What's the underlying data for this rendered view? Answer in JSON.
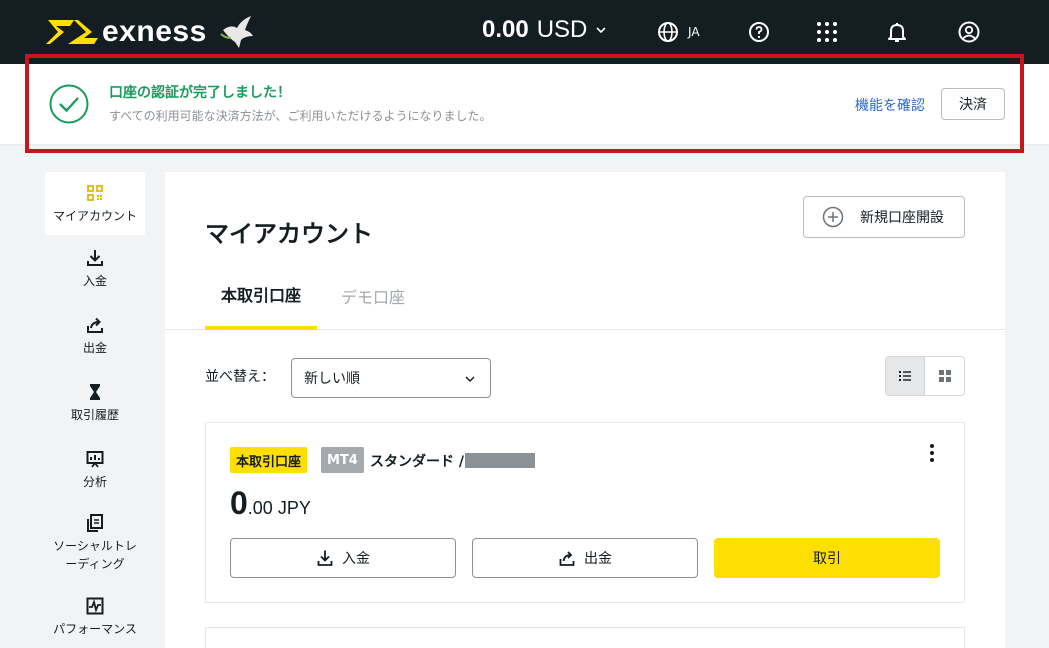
{
  "header": {
    "brand": "exness",
    "balance_amount": "0.00",
    "balance_currency": "USD",
    "language": "JA"
  },
  "banner": {
    "title": "口座の認証が完了しました！",
    "subtitle": "すべての利用可能な決済方法が、ご利用いただけるようになりました。",
    "link_label": "機能を確認",
    "button_label": "決済"
  },
  "sidebar": {
    "items": [
      {
        "label": "マイアカウント",
        "icon": "grid-dashboard-icon"
      },
      {
        "label": "入金",
        "icon": "download-icon"
      },
      {
        "label": "出金",
        "icon": "upload-share-icon"
      },
      {
        "label": "取引履歴",
        "icon": "hourglass-icon"
      },
      {
        "label": "分析",
        "icon": "chart-board-icon"
      },
      {
        "label": "ソーシャルトレーディング",
        "icon": "copy-document-icon"
      },
      {
        "label": "パフォーマンス",
        "icon": "pulse-chart-icon"
      }
    ]
  },
  "main": {
    "title": "マイアカウント",
    "new_account_label": "新規口座開設",
    "tabs": [
      {
        "label": "本取引口座",
        "active": true
      },
      {
        "label": "デモ口座",
        "active": false
      }
    ],
    "sort_label": "並べ替え：",
    "sort_value": "新しい順"
  },
  "account_card": {
    "badge_type": "本取引口座",
    "badge_platform": "MT4",
    "account_type": "スタンダード /",
    "amount_int": "0",
    "amount_rest": ".00 JPY",
    "deposit_label": "入金",
    "withdraw_label": "出金",
    "trade_label": "取引"
  },
  "colors": {
    "accent_yellow": "#ffde02",
    "topbar": "#141d22",
    "success_green": "#1a9c5d",
    "link_blue": "#2a6bd1",
    "highlight_red": "#c8151b"
  }
}
